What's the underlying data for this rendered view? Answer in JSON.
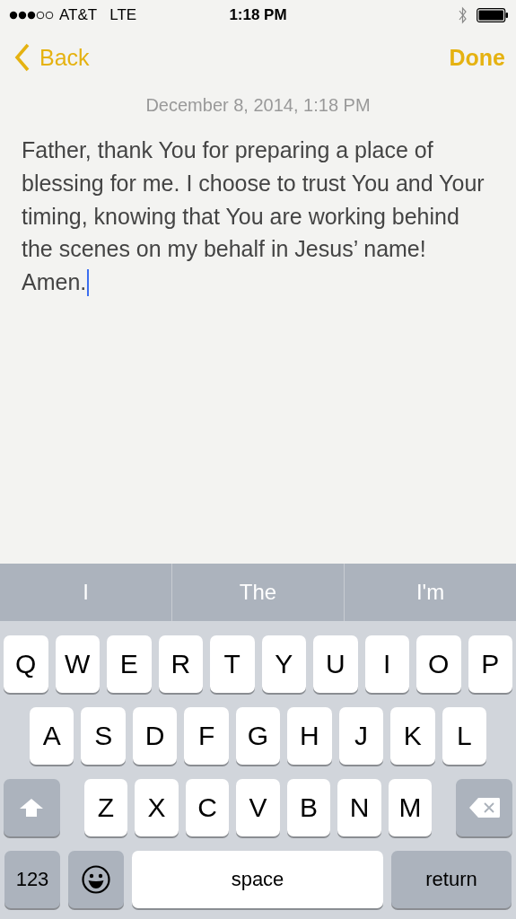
{
  "status_bar": {
    "carrier": "AT&T",
    "network": "LTE",
    "time": "1:18 PM"
  },
  "nav": {
    "back": "Back",
    "done": "Done"
  },
  "note": {
    "date": "December 8, 2014, 1:18 PM",
    "text": "Father, thank You for preparing a place of blessing for me. I choose to trust You and Your timing, knowing that You are working behind the scenes on my behalf in Jesus’ name! Amen."
  },
  "suggestions": [
    "I",
    "The",
    "I'm"
  ],
  "keyboard": {
    "rows": [
      {
        "keys": [
          {
            "kind": "letter",
            "label": "Q"
          },
          {
            "kind": "letter",
            "label": "W"
          },
          {
            "kind": "letter",
            "label": "E"
          },
          {
            "kind": "letter",
            "label": "R"
          },
          {
            "kind": "letter",
            "label": "T"
          },
          {
            "kind": "letter",
            "label": "Y"
          },
          {
            "kind": "letter",
            "label": "U"
          },
          {
            "kind": "letter",
            "label": "I"
          },
          {
            "kind": "letter",
            "label": "O"
          },
          {
            "kind": "letter",
            "label": "P"
          }
        ]
      },
      {
        "keys": [
          {
            "kind": "letter",
            "label": "A"
          },
          {
            "kind": "letter",
            "label": "S"
          },
          {
            "kind": "letter",
            "label": "D"
          },
          {
            "kind": "letter",
            "label": "F"
          },
          {
            "kind": "letter",
            "label": "G"
          },
          {
            "kind": "letter",
            "label": "H"
          },
          {
            "kind": "letter",
            "label": "J"
          },
          {
            "kind": "letter",
            "label": "K"
          },
          {
            "kind": "letter",
            "label": "L"
          }
        ]
      },
      {
        "keys": [
          {
            "kind": "shift"
          },
          {
            "kind": "letter",
            "label": "Z"
          },
          {
            "kind": "letter",
            "label": "X"
          },
          {
            "kind": "letter",
            "label": "C"
          },
          {
            "kind": "letter",
            "label": "V"
          },
          {
            "kind": "letter",
            "label": "B"
          },
          {
            "kind": "letter",
            "label": "N"
          },
          {
            "kind": "letter",
            "label": "M"
          },
          {
            "kind": "delete"
          }
        ]
      },
      {
        "keys": [
          {
            "kind": "numbers",
            "label": "123"
          },
          {
            "kind": "emoji"
          },
          {
            "kind": "space",
            "label": "space"
          },
          {
            "kind": "return",
            "label": "return"
          }
        ]
      }
    ]
  }
}
